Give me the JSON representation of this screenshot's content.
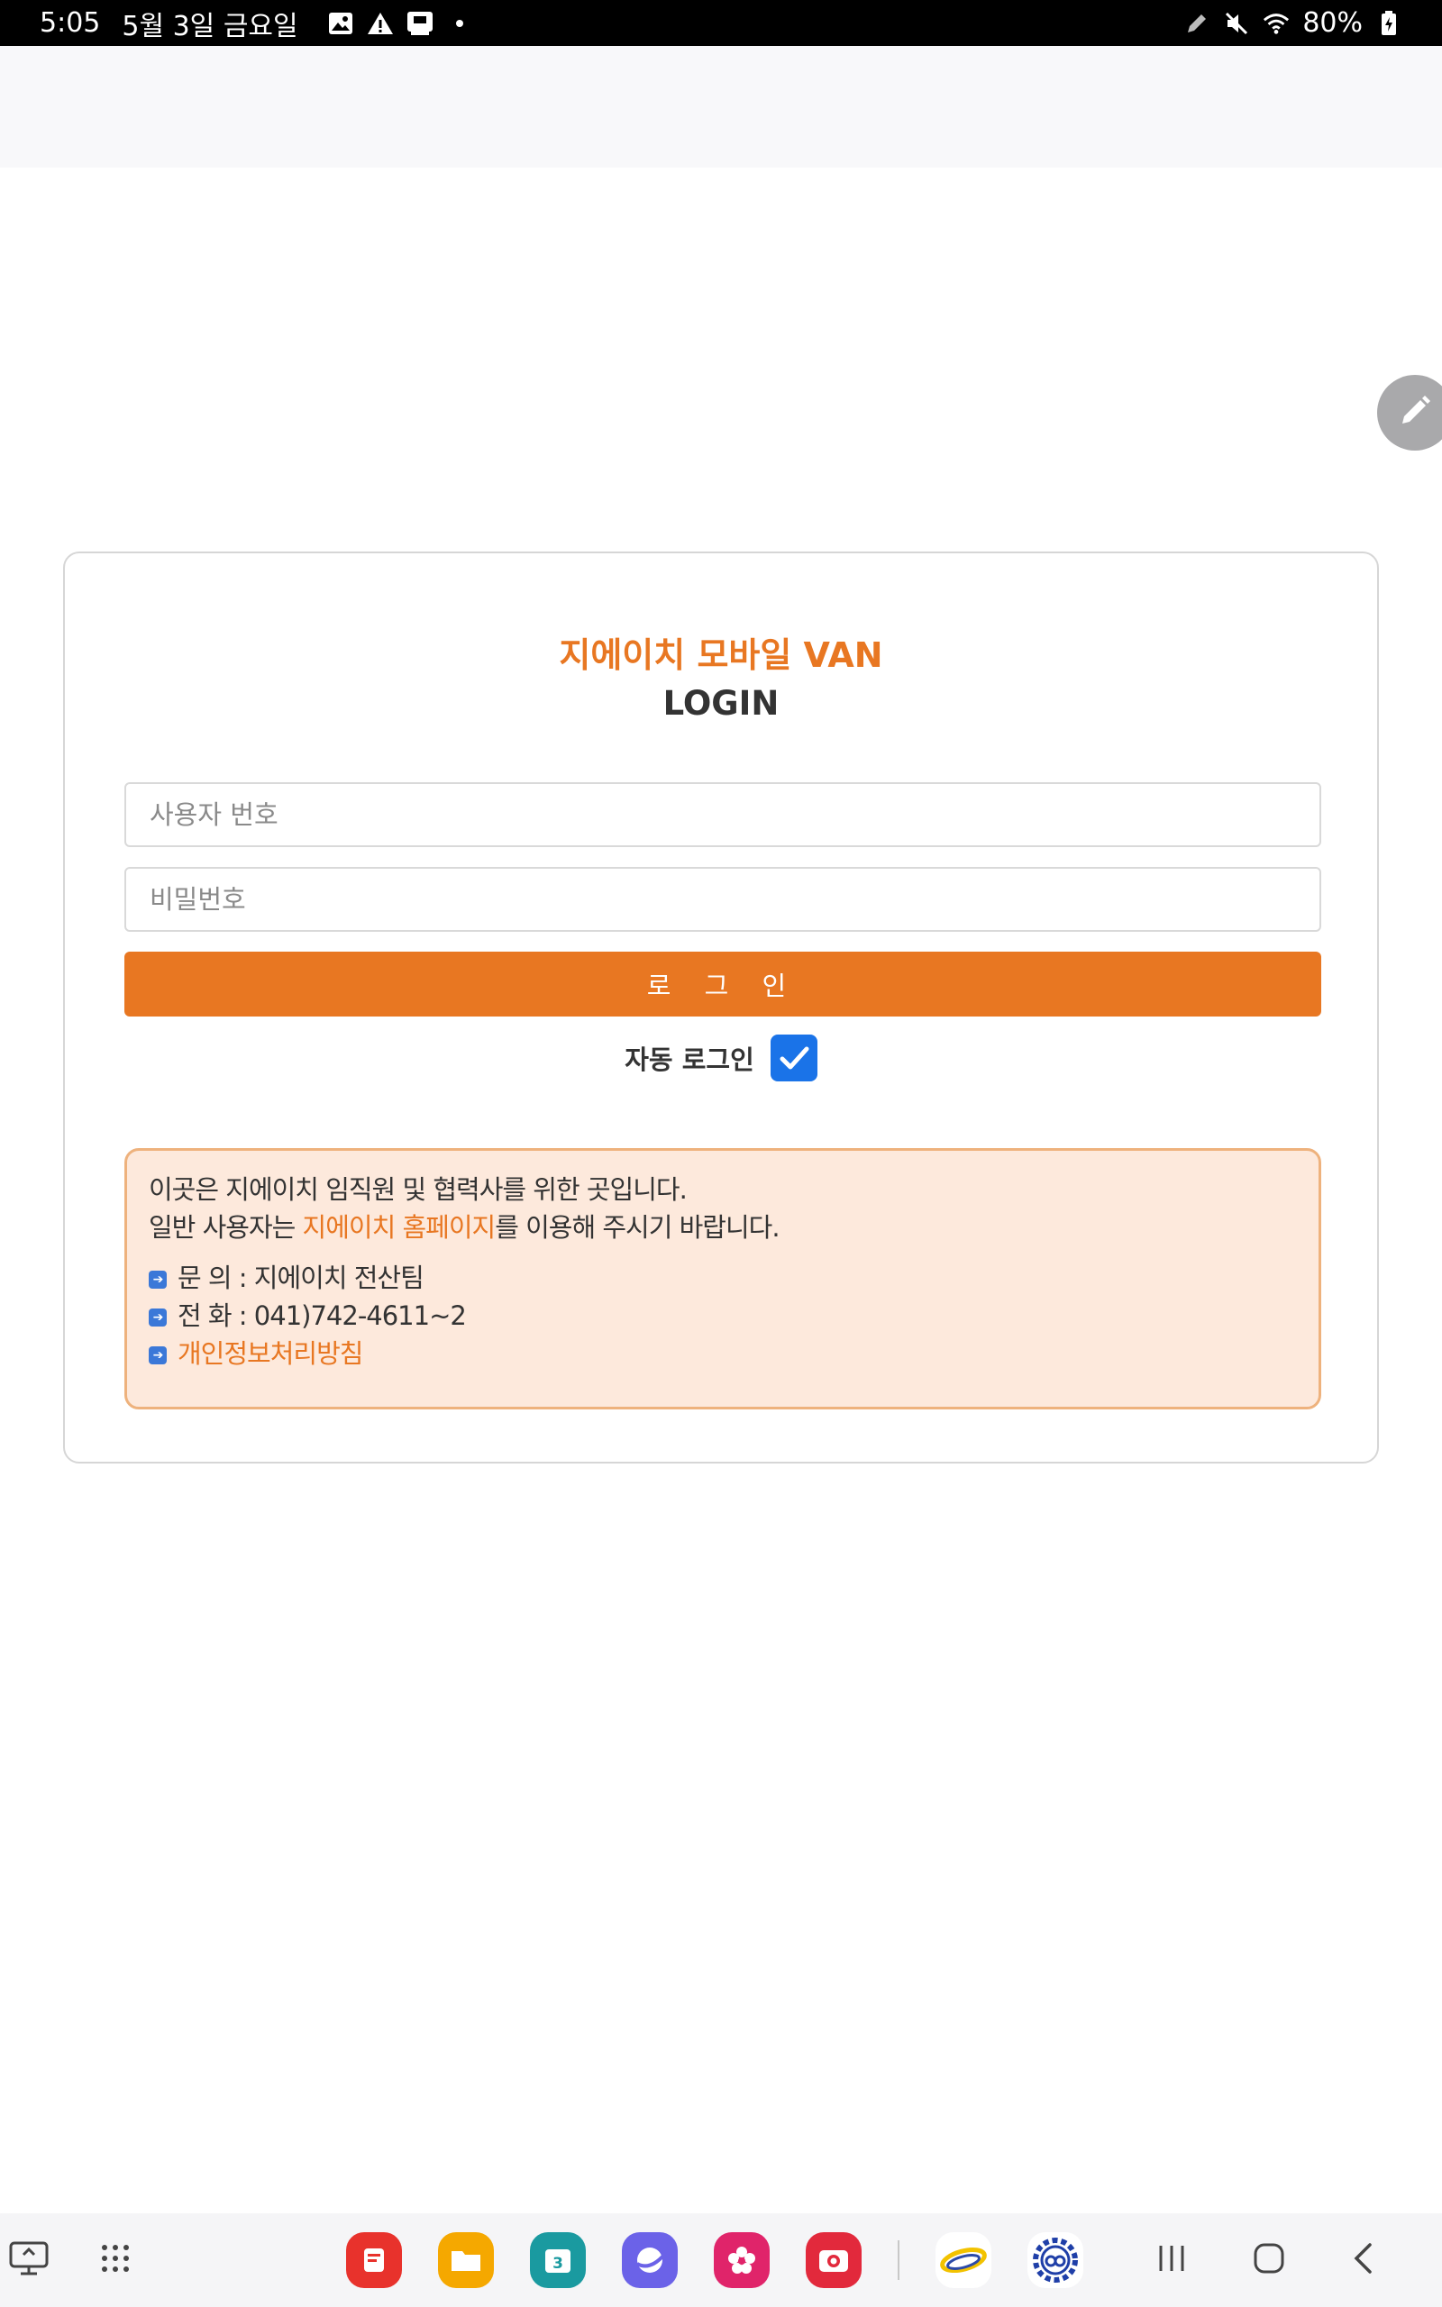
{
  "status_bar": {
    "time": "5:05",
    "date": "5월 3일 금요일",
    "battery": "80%",
    "left_icons": [
      "gallery-icon",
      "warning-icon",
      "screenshot-icon",
      "dot-icon"
    ],
    "right_icons": [
      "pen-icon",
      "mute-icon",
      "wifi-icon",
      "battery-icon"
    ]
  },
  "login": {
    "title": "지에이치 모바일 VAN",
    "subtitle": "LOGIN",
    "userid_placeholder": "사용자 번호",
    "password_placeholder": "비밀번호",
    "login_button": "로 그 인",
    "auto_login_label": "자동 로그인",
    "auto_login_checked": true
  },
  "info": {
    "line1": "이곳은 지에이치 임직원 및 협력사를 위한 곳입니다.",
    "line2_prefix": "일반 사용자는 ",
    "line2_link": "지에이치 홈페이지",
    "line2_suffix": "를 이용해 주시기 바랍니다.",
    "contact_label": "문 의 : ",
    "contact_value": "지에이치 전산팀",
    "phone_label": "전 화 : ",
    "phone_value": "041)742-4611~2",
    "privacy_link": "개인정보처리방침"
  },
  "colors": {
    "accent": "#e87722",
    "info_bg": "#fde9dc",
    "info_border": "#eeb27d",
    "checkbox": "#1a73e8"
  },
  "taskbar": {
    "apps": [
      "notes-app-icon",
      "files-app-icon",
      "calendar-app-icon",
      "internet-app-icon",
      "flower-app-icon",
      "camera-app-icon",
      "van-app-icon",
      "settings-gear-app-icon"
    ],
    "calendar_day": "3"
  }
}
